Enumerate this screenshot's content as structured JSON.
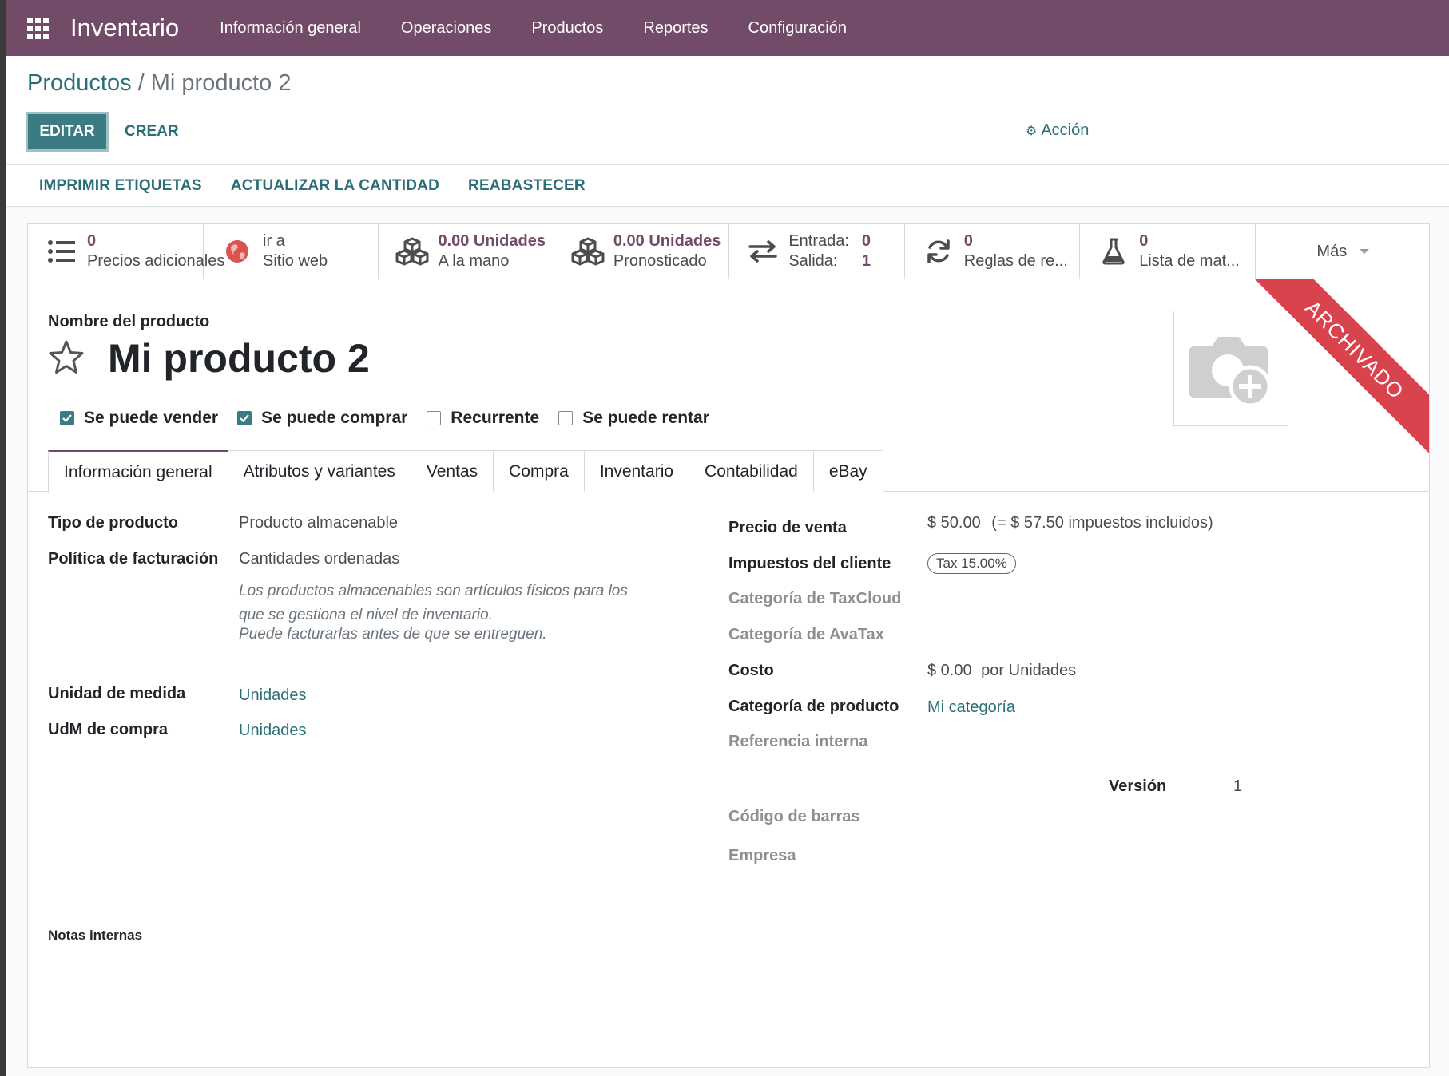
{
  "navbar": {
    "brand": "Inventario",
    "menu": [
      "Información general",
      "Operaciones",
      "Productos",
      "Reportes",
      "Configuración"
    ]
  },
  "breadcrumb": {
    "parent": "Productos",
    "separator": "/",
    "current": "Mi producto 2"
  },
  "controls": {
    "edit": "EDITAR",
    "create": "CREAR",
    "action": "Acción"
  },
  "statusbar": {
    "buttons": [
      "IMPRIMIR ETIQUETAS",
      "ACTUALIZAR LA CANTIDAD",
      "REABASTECER"
    ]
  },
  "smart_buttons": {
    "extra_prices": {
      "value": "0",
      "label": "Precios adicionales"
    },
    "website": {
      "value": "ir a",
      "label": "Sitio web"
    },
    "on_hand": {
      "value": "0.00 Unidades",
      "label": "A la mano"
    },
    "forecast": {
      "value": "0.00 Unidades",
      "label": "Pronosticado"
    },
    "moves": {
      "in_label": "Entrada:",
      "in_value": "0",
      "out_label": "Salida:",
      "out_value": "1"
    },
    "rules": {
      "value": "0",
      "label": "Reglas de re..."
    },
    "bom": {
      "value": "0",
      "label": "Lista de mat..."
    },
    "more": "Más"
  },
  "ribbon": "ARCHIVADO",
  "product": {
    "name_label": "Nombre del producto",
    "name": "Mi producto 2",
    "options": [
      {
        "label": "Se puede vender",
        "checked": true
      },
      {
        "label": "Se puede comprar",
        "checked": true
      },
      {
        "label": "Recurrente",
        "checked": false
      },
      {
        "label": "Se puede rentar",
        "checked": false
      }
    ]
  },
  "tabs": [
    "Información general",
    "Atributos y variantes",
    "Ventas",
    "Compra",
    "Inventario",
    "Contabilidad",
    "eBay"
  ],
  "general": {
    "type_label": "Tipo de producto",
    "type_value": "Producto almacenable",
    "invoice_label": "Política de facturación",
    "invoice_value": "Cantidades ordenadas",
    "help1a": "Los productos almacenables son artículos físicos para los",
    "help1b": "que se gestiona el nivel de inventario.",
    "help2": "Puede facturarlas antes de que se entreguen.",
    "uom_label": "Unidad de medida",
    "uom_value": "Unidades",
    "uom_po_label": "UdM de compra",
    "uom_po_value": "Unidades",
    "price_label": "Precio de venta",
    "price_value": "$ 50.00",
    "price_tax": "(= $ 57.50 impuestos incluidos)",
    "taxes_label": "Impuestos del cliente",
    "tax_tag": "Tax 15.00%",
    "taxcloud_label": "Categoría de TaxCloud",
    "avatax_label": "Categoría de AvaTax",
    "cost_label": "Costo",
    "cost_value": "$ 0.00",
    "cost_unit": "por Unidades",
    "categ_label": "Categoría de producto",
    "categ_value": "Mi categoría",
    "ref_label": "Referencia interna",
    "version_label": "Versión",
    "version_value": "1",
    "barcode_label": "Código de barras",
    "company_label": "Empresa",
    "notes_label": "Notas internas"
  }
}
